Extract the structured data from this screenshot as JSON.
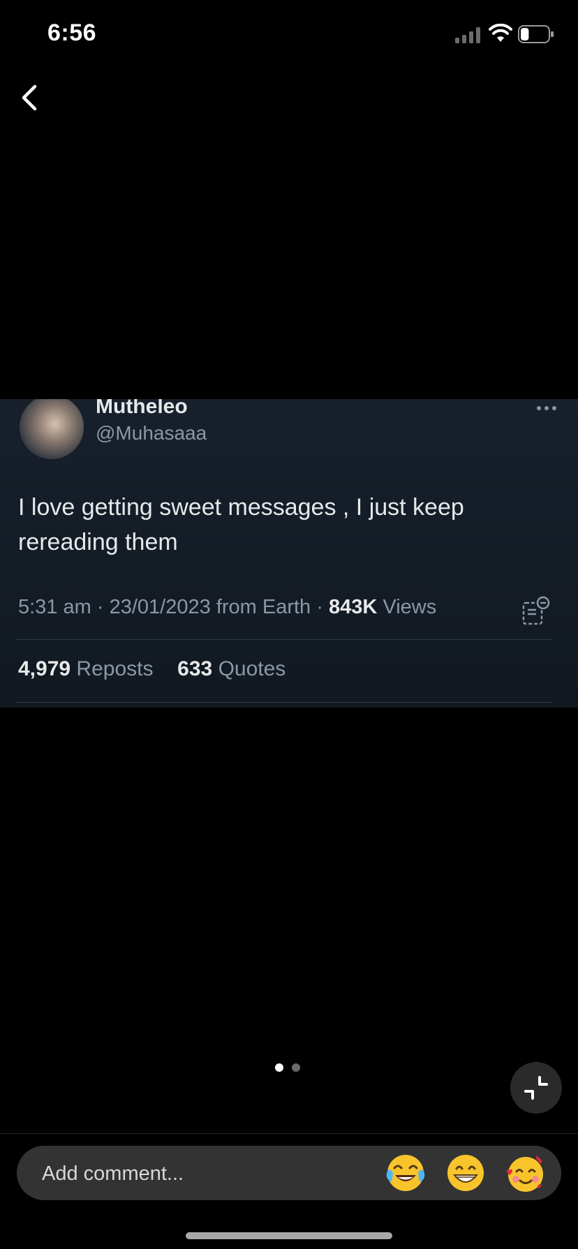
{
  "status_bar": {
    "time": "6:56",
    "battery_level": 0.3
  },
  "tweet": {
    "display_name": "Mutheleo",
    "handle": "@Muhasaaa",
    "text": "I love getting sweet messages , I just keep rereading them",
    "time": "5:31 am",
    "date": "23/01/2023",
    "source": "from Earth",
    "separator": "·",
    "views_count": "843K",
    "views_label": "Views",
    "reposts_count": "4,979",
    "reposts_label": "Reposts",
    "quotes_count": "633",
    "quotes_label": "Quotes"
  },
  "pager": {
    "total": 2,
    "active": 1
  },
  "comment": {
    "placeholder": "Add comment...",
    "emojis": [
      "face-with-tears-of-joy-emoji",
      "grinning-face-emoji",
      "smiling-face-with-hearts-emoji"
    ]
  },
  "colors": {
    "background": "#000000",
    "card": "#15202b",
    "text_primary": "#e7e9ea",
    "text_secondary": "#8b98a5",
    "comment_bar": "#333333"
  }
}
